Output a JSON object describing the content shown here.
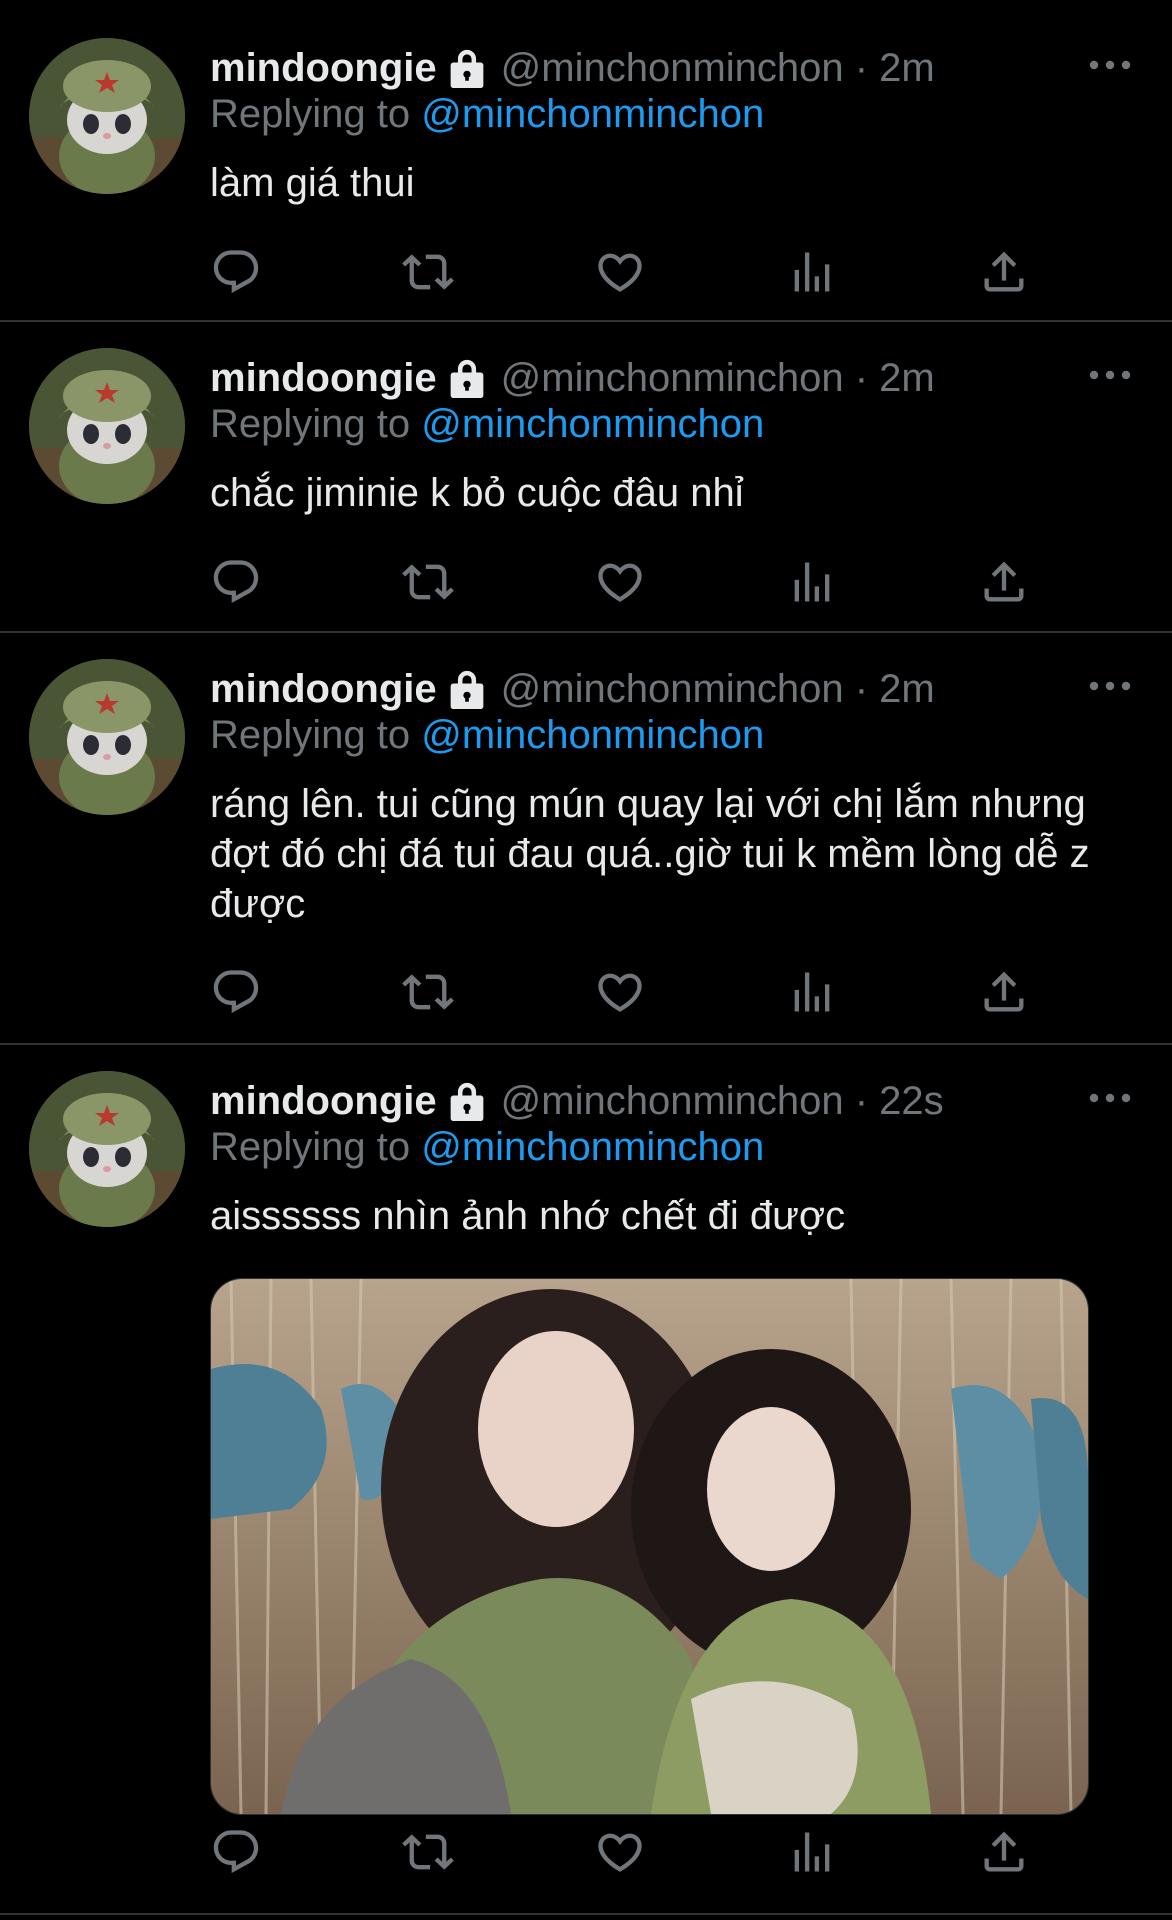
{
  "tweets": [
    {
      "name": "mindoongie",
      "handle_time": "@minchonminchon · 2m",
      "replying_prefix": "Replying to ",
      "replying_to": "@minchonminchon",
      "text": "làm giá thui"
    },
    {
      "name": "mindoongie",
      "handle_time": "@minchonminchon · 2m",
      "replying_prefix": "Replying to ",
      "replying_to": "@minchonminchon",
      "text": "chắc jiminie k bỏ cuộc đâu nhỉ"
    },
    {
      "name": "mindoongie",
      "handle_time": "@minchonminchon · 2m",
      "replying_prefix": "Replying to ",
      "replying_to": "@minchonminchon",
      "text": "ráng lên. tui cũng mún quay lại với chị lắm nhưng đợt đó chị đá tui đau quá..giờ tui k mềm lòng dễ z được"
    },
    {
      "name": "mindoongie",
      "handle_time": "@minchonminchon · 22s",
      "replying_prefix": "Replying to ",
      "replying_to": "@minchonminchon",
      "text": "aissssss nhìn ảnh nhớ chết đi được"
    }
  ],
  "icons": {
    "reply": "reply-icon",
    "retweet": "retweet-icon",
    "like": "heart-icon",
    "views": "views-icon",
    "share": "share-icon",
    "more": "more-icon",
    "protected": "lock-icon"
  },
  "colors": {
    "background": "#000000",
    "text": "#e7e9ea",
    "secondary": "#71767b",
    "accent": "#1d9bf0",
    "divider": "#2f3336"
  }
}
